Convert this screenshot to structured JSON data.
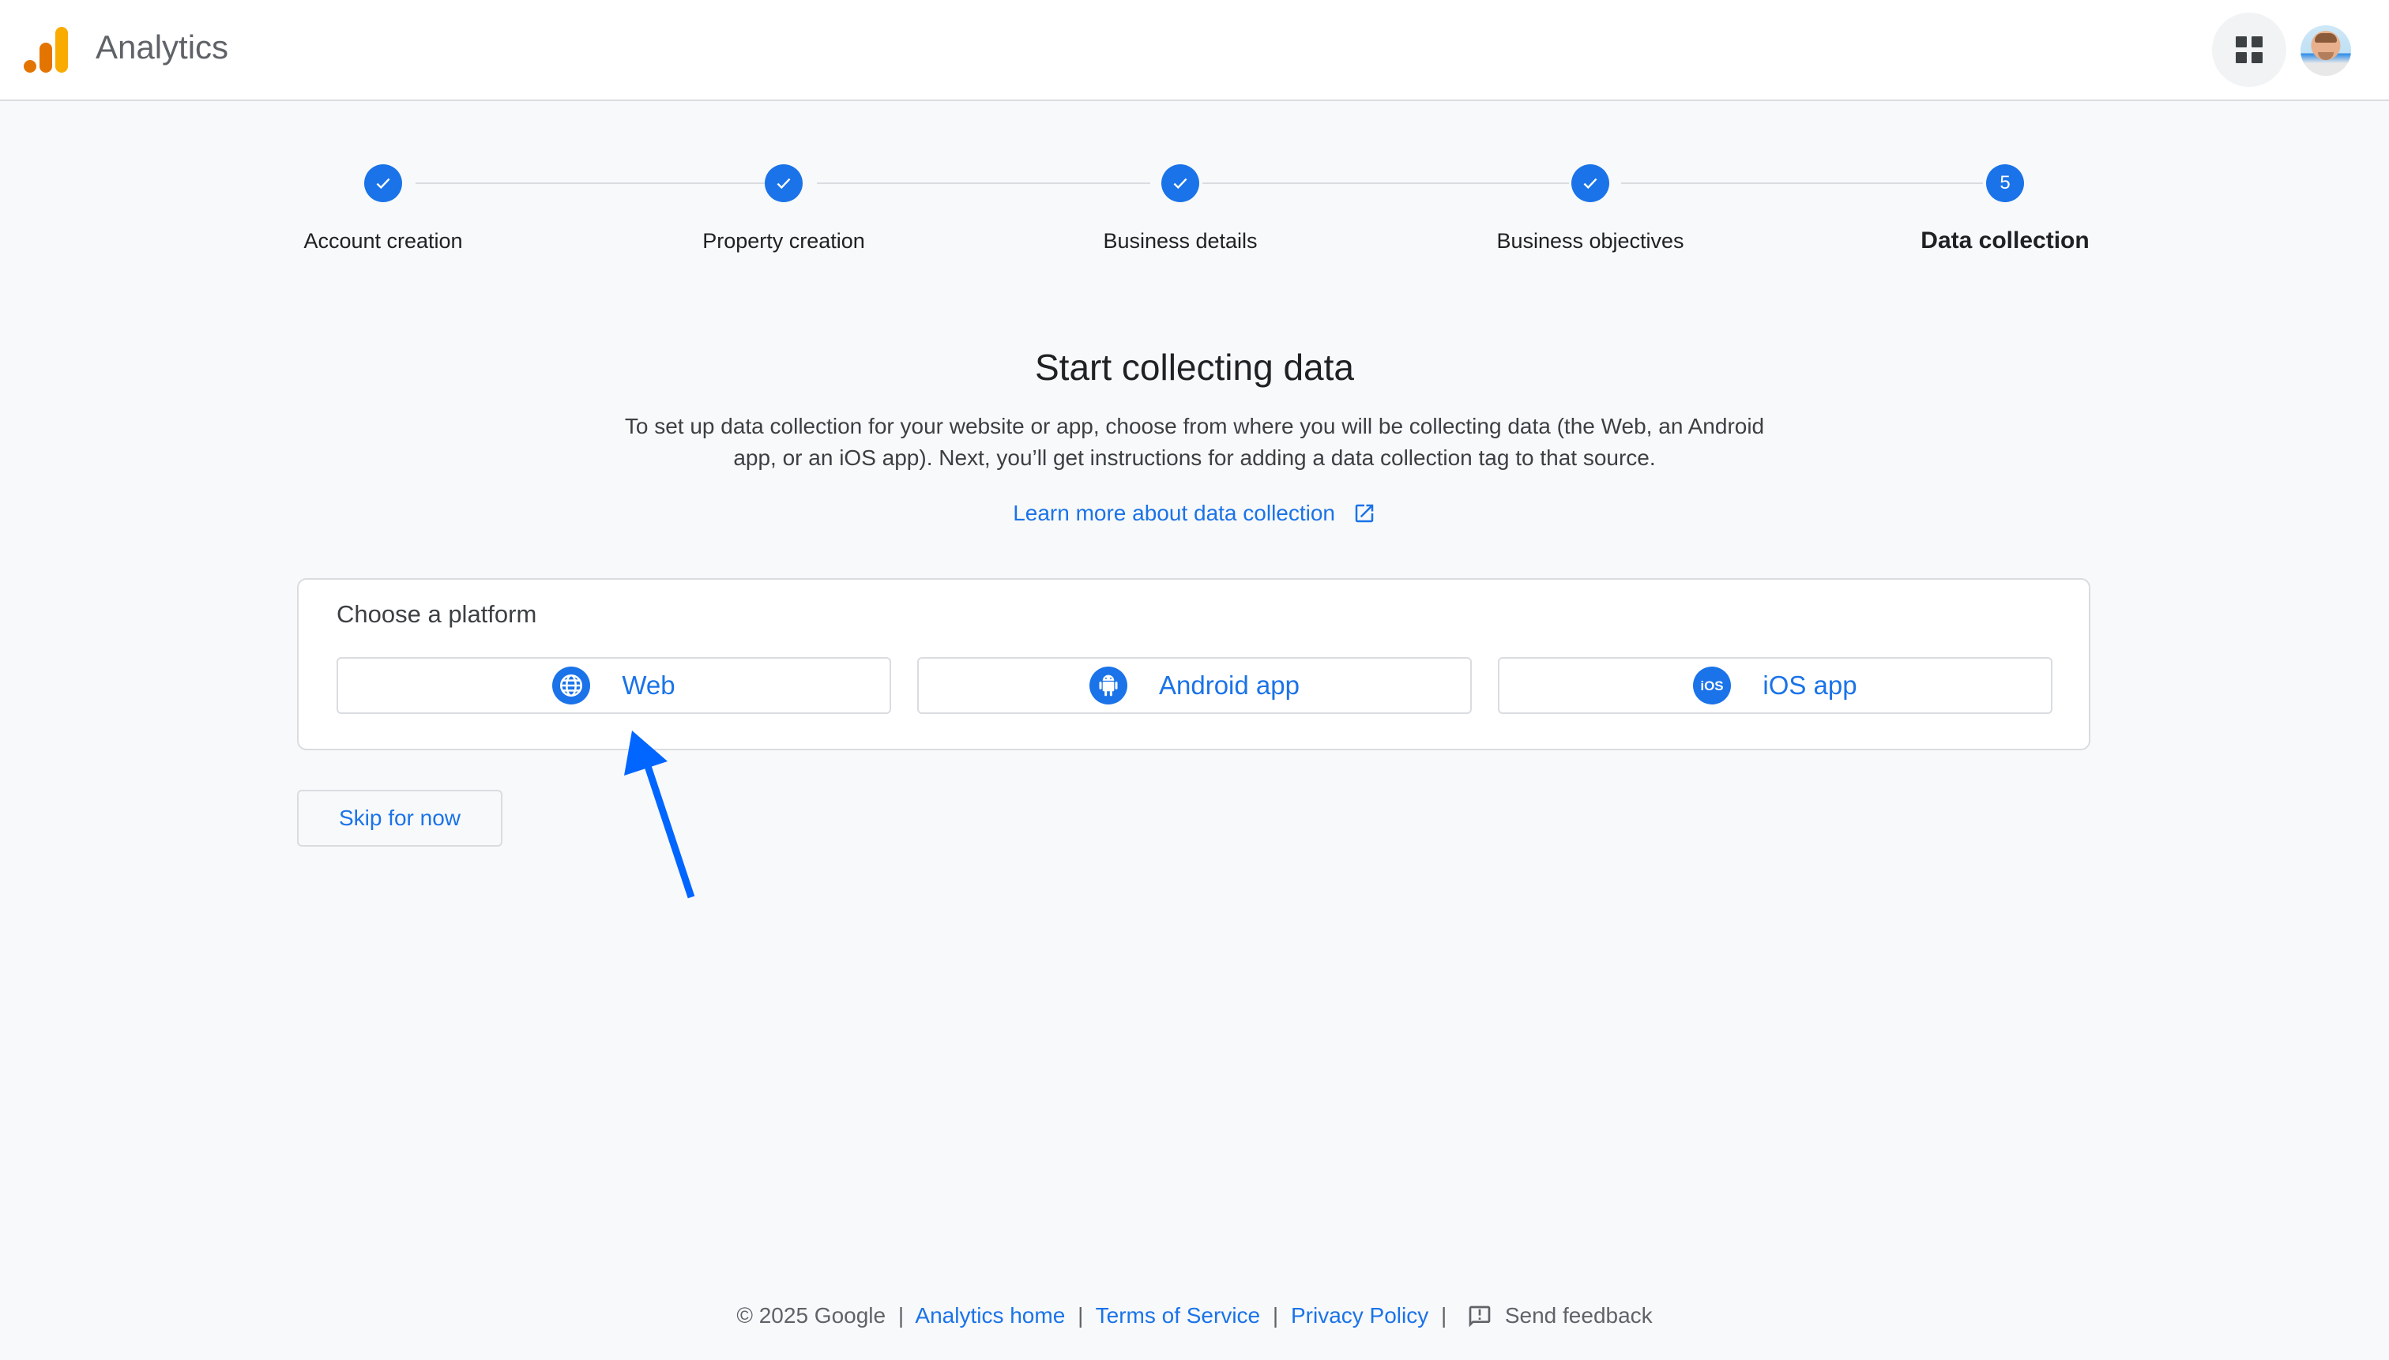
{
  "header": {
    "app_title": "Analytics",
    "logo_icon": "analytics-logo-icon",
    "apps_icon": "google-apps-grid-icon",
    "avatar_icon": "user-avatar"
  },
  "stepper": {
    "steps": [
      {
        "label": "Account creation",
        "status": "completed",
        "marker": "check-icon"
      },
      {
        "label": "Property creation",
        "status": "completed",
        "marker": "check-icon"
      },
      {
        "label": "Business details",
        "status": "completed",
        "marker": "check-icon"
      },
      {
        "label": "Business objectives",
        "status": "completed",
        "marker": "check-icon"
      },
      {
        "label": "Data collection",
        "status": "active",
        "number": "5"
      }
    ]
  },
  "main": {
    "title": "Start collecting data",
    "description_line1": "To set up data collection for your website or app, choose from where you will be collecting data (the Web, an Android",
    "description_line2": "app, or an iOS app). Next, you’ll get instructions for adding a data collection tag to that source.",
    "learn_more": "Learn more about data collection",
    "learn_more_icon": "open-in-new-icon"
  },
  "platform_card": {
    "title": "Choose a platform",
    "options": [
      {
        "label": "Web",
        "icon": "globe-icon"
      },
      {
        "label": "Android app",
        "icon": "android-icon"
      },
      {
        "label": "iOS app",
        "icon": "ios-icon"
      }
    ]
  },
  "skip_label": "Skip for now",
  "annotation": {
    "arrow_color": "#0066ff",
    "points_to": "Web"
  },
  "footer": {
    "copyright": "© 2025 Google",
    "links": [
      "Analytics home",
      "Terms of Service",
      "Privacy Policy"
    ],
    "separator": "|",
    "feedback": "Send feedback"
  },
  "colors": {
    "accent": "#1a73e8",
    "background": "#f8f9fa",
    "logo_orange": "#e37400",
    "logo_yellow": "#f9ab00"
  }
}
